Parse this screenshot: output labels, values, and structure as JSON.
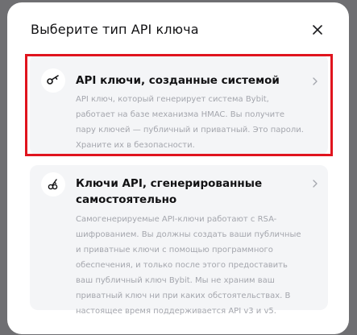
{
  "modal": {
    "title": "Выберите тип API ключа",
    "close_icon": "close-icon"
  },
  "options": [
    {
      "icon": "key-icon",
      "title": "API ключи, созданные системой",
      "description": "API ключ, который генерирует система Bybit, работает на базе механизма HMAC. Вы получите пару ключей — публичный и приватный. Это пароли. Храните их в безопасности.",
      "chevron_icon": "chevron-right-icon",
      "highlighted": true
    },
    {
      "icon": "key-pair-icon",
      "title": "Ключи API, сгенерированные самостоятельно",
      "description": "Самогенерируемые API-ключи работают с RSA-шифрованием. Вы должны создать ваши публичные и приватные ключи с помощью программного обеспечения, и только после этого предоставить ваш публичный ключ Bybit. Мы не храним ваш приватный ключ ни при каких обстоятельствах. В настоящее время поддерживается API v3 и v5.",
      "chevron_icon": "chevron-right-icon",
      "highlighted": false
    }
  ],
  "colors": {
    "highlight": "#e0141e",
    "card_bg": "#f4f5f7",
    "title_text": "#121214",
    "desc_text": "#a4a6ad"
  }
}
